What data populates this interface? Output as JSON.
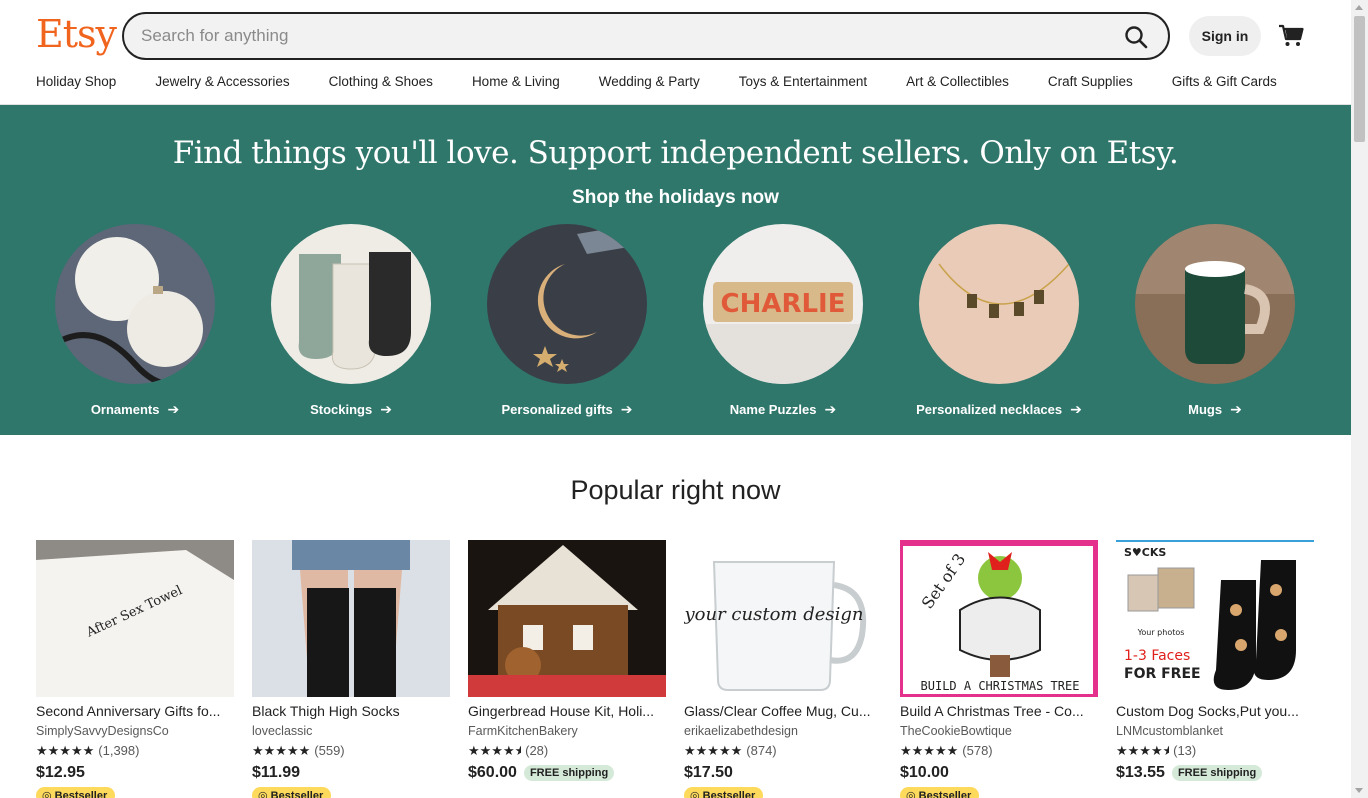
{
  "brand": {
    "logo": "Etsy",
    "color": "#f1641e",
    "hero_color": "#2f766b"
  },
  "search": {
    "placeholder": "Search for anything",
    "value": ""
  },
  "header": {
    "sign_in": "Sign in"
  },
  "icons": {
    "search": "search-icon",
    "cart": "cart-icon",
    "arrow": "arrow-right-icon",
    "star": "star-icon",
    "bestseller": "award-icon"
  },
  "nav": [
    "Holiday Shop",
    "Jewelry & Accessories",
    "Clothing & Shoes",
    "Home & Living",
    "Wedding & Party",
    "Toys & Entertainment",
    "Art & Collectibles",
    "Craft Supplies",
    "Gifts & Gift Cards"
  ],
  "hero": {
    "title": "Find things you'll love. Support independent sellers. Only on Etsy.",
    "subtitle": "Shop the holidays now",
    "categories": [
      {
        "label": "Ornaments",
        "image_text": ""
      },
      {
        "label": "Stockings",
        "image_text": ""
      },
      {
        "label": "Personalized gifts",
        "image_text": ""
      },
      {
        "label": "Name Puzzles",
        "image_text": "CHARLIE"
      },
      {
        "label": "Personalized necklaces",
        "image_text": ""
      },
      {
        "label": "Mugs",
        "image_text": ""
      }
    ]
  },
  "popular": {
    "title": "Popular right now",
    "items": [
      {
        "title": "Second Anniversary Gifts fo...",
        "shop": "SimplySavvyDesignsCo",
        "stars": 5,
        "reviews": "(1,398)",
        "price": "$12.95",
        "free_shipping": "",
        "badge": "Bestseller"
      },
      {
        "title": "Black Thigh High Socks",
        "shop": "loveclassic",
        "stars": 5,
        "reviews": "(559)",
        "price": "$11.99",
        "free_shipping": "",
        "badge": "Bestseller"
      },
      {
        "title": "Gingerbread House Kit, Holi...",
        "shop": "FarmKitchenBakery",
        "stars": 4.5,
        "reviews": "(28)",
        "price": "$60.00",
        "free_shipping": "FREE shipping",
        "badge": ""
      },
      {
        "title": "Glass/Clear Coffee Mug, Cu...",
        "shop": "erikaelizabethdesign",
        "stars": 5,
        "reviews": "(874)",
        "price": "$17.50",
        "free_shipping": "",
        "badge": "Bestseller"
      },
      {
        "title": "Build A Christmas Tree - Co...",
        "shop": "TheCookieBowtique",
        "stars": 5,
        "reviews": "(578)",
        "price": "$10.00",
        "free_shipping": "",
        "badge": "Bestseller"
      },
      {
        "title": "Custom Dog Socks,Put you...",
        "shop": "LNMcustomblanket",
        "stars": 4.5,
        "reviews": "(13)",
        "price": "$13.55",
        "free_shipping": "FREE shipping",
        "badge": ""
      }
    ],
    "image_text": {
      "towel": "After Sex Towel",
      "mug": "your custom design",
      "tree_top": "Set of 3",
      "tree_bottom": "BUILD A CHRISTMAS TREE",
      "socks_top": "S♥CKS",
      "socks_photos": "Your photos",
      "socks_faces": "1-3 Faces",
      "socks_free": "FOR FREE"
    }
  }
}
